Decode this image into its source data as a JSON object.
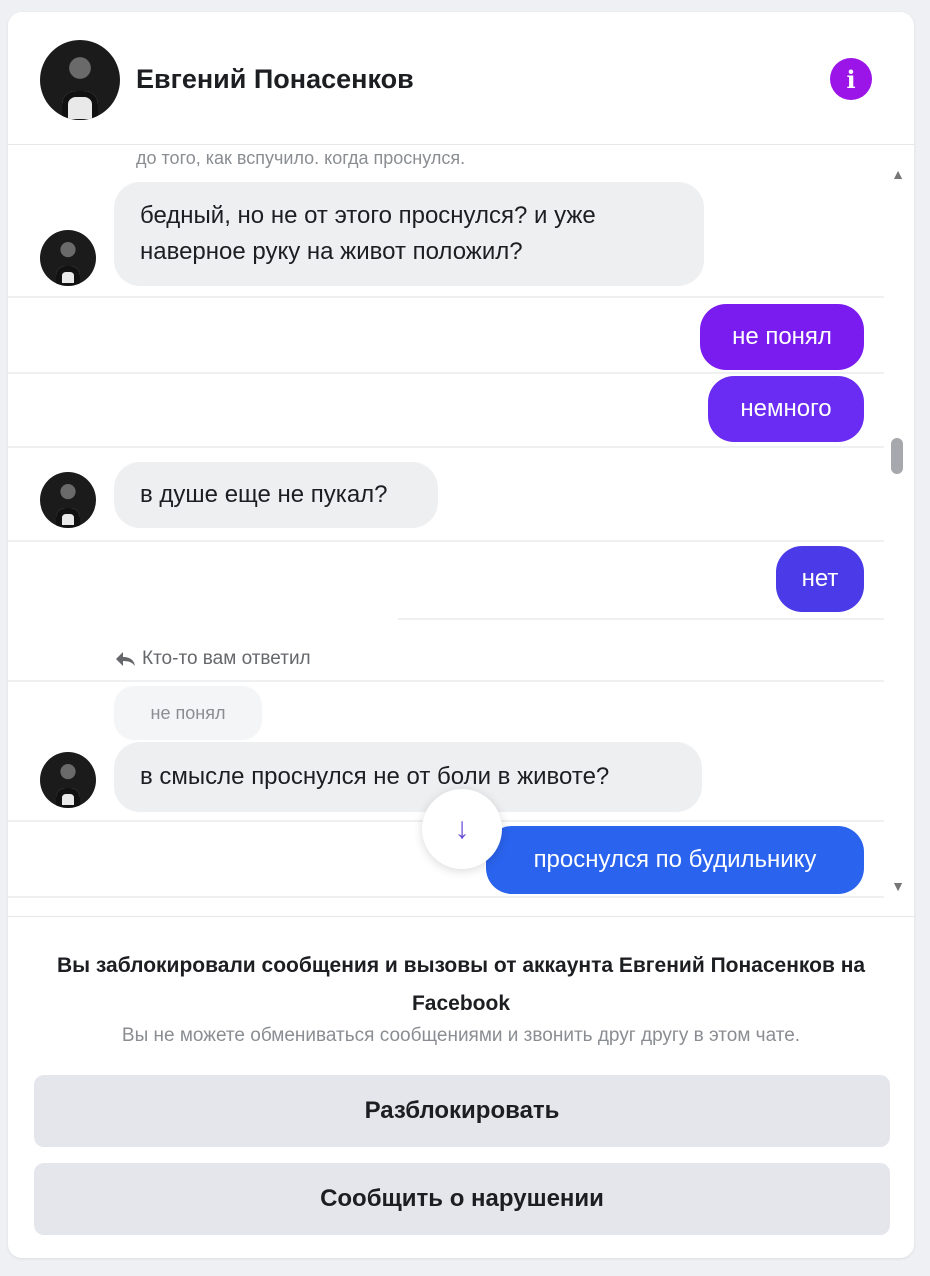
{
  "header": {
    "contact_name": "Евгений Понасенков",
    "info_icon": "i"
  },
  "colors": {
    "accent_purple": "#9b14e8",
    "out_bubble_1": "#7a1cf0",
    "out_bubble_2": "#6a2bf2",
    "out_bubble_3": "#4a3ae8",
    "out_bubble_4": "#2a63ee"
  },
  "messages": {
    "clipped_top": "до того, как вспучило. когда проснулся.",
    "m1": "бедный, но не от этого проснулся? и уже наверное руку на живот положил?",
    "m2": "не понял",
    "m3": "немного",
    "m4": "в душе еще не пукал?",
    "m5": "нет",
    "reply_note": "Кто-то вам ответил",
    "quoted": "не понял",
    "m6": "в смысле проснулся не от боли в животе?",
    "m7": "проснулся по будильнику"
  },
  "icons": {
    "scroll_down": "↓",
    "reply": "reply-icon",
    "scroll_up": "▲",
    "scroll_down_small": "▼"
  },
  "footer": {
    "blocked_title": "Вы заблокировали сообщения и вызовы от аккаунта Евгений Понасенков на Facebook",
    "blocked_sub": "Вы не можете обмениваться сообщениями и звонить друг другу в этом чате.",
    "unblock": "Разблокировать",
    "report": "Сообщить о нарушении"
  }
}
